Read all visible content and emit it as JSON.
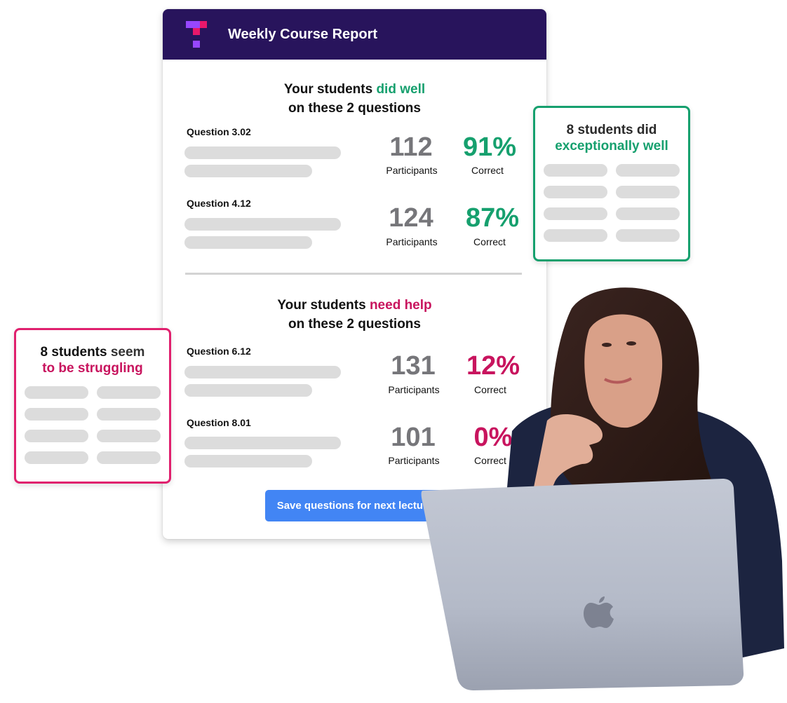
{
  "report": {
    "title": "Weekly Course Report",
    "logo_icon": "top-hat-logo",
    "colors": {
      "header_bg": "#28145c",
      "good": "#16a06e",
      "bad": "#c8145e",
      "button": "#4285f4"
    },
    "good_section": {
      "title_prefix": "Your students ",
      "title_highlight": "did well",
      "title_line2": "on these 2 questions",
      "questions": [
        {
          "label": "Question 3.02",
          "participants": "112",
          "participants_label": "Participants",
          "correct": "91%",
          "correct_label": "Correct"
        },
        {
          "label": "Question 4.12",
          "participants": "124",
          "participants_label": "Participants",
          "correct": "87%",
          "correct_label": "Correct"
        }
      ]
    },
    "bad_section": {
      "title_prefix": "Your students ",
      "title_highlight": "need help",
      "title_line2": "on these 2 questions",
      "questions": [
        {
          "label": "Question 6.12",
          "participants": "131",
          "participants_label": "Participants",
          "correct": "12%",
          "correct_label": "Correct"
        },
        {
          "label": "Question 8.01",
          "participants": "101",
          "participants_label": "Participants",
          "correct": "0%",
          "correct_label": "Correct"
        }
      ]
    },
    "save_button_label": "Save questions for next lecture"
  },
  "good_card": {
    "title_line1": "8 students did",
    "title_line2": "exceptionally well",
    "border_color": "#16a06e"
  },
  "bad_card": {
    "title_line1_dark": "8 students",
    "title_line1_grey": " seem",
    "title_line2": "to be struggling",
    "border_color": "#e0206e"
  },
  "illustration": {
    "subject": "woman-with-laptop",
    "laptop_logo_icon": "apple-logo-icon"
  }
}
